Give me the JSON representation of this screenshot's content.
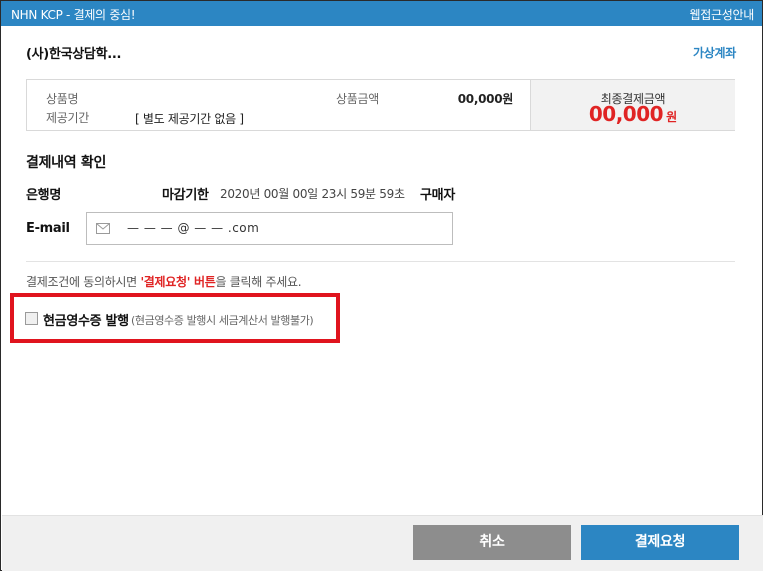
{
  "titlebar": {
    "title": "NHN KCP - 결제의 중심!",
    "accessibility_link": "웹접근성안내"
  },
  "merchant": {
    "name": "(사)한국상담학...",
    "payment_method": "가상계좌"
  },
  "summary": {
    "product_name_label": "상품명",
    "service_period_label": "제공기간",
    "service_period_value": "[ 별도 제공기간 없음 ]",
    "product_amount_label": "상품금액",
    "product_amount_value": "00,000원",
    "final_amount_label": "최종결제금액",
    "final_amount_value": "00,000",
    "final_amount_unit": "원"
  },
  "details": {
    "section_title": "결제내역 확인",
    "bank_label": "은행명",
    "deadline_label": "마감기한",
    "deadline_value": "2020년 00월 00일 23시 59분 59초",
    "buyer_label": "구매자",
    "email_label": "E-mail",
    "email_value": "— — — @ — — .com"
  },
  "notice": {
    "prefix": "결제조건에 동의하시면 ",
    "highlight": "'결제요청' 버튼",
    "suffix": "을 클릭해 주세요."
  },
  "receipt": {
    "label": "현금영수증 발행",
    "note": "(현금영수증 발행시 세금계산서 발행불가)",
    "checked": false
  },
  "buttons": {
    "cancel": "취소",
    "pay": "결제요청"
  },
  "colors": {
    "brand_blue": "#2c86c3",
    "amount_red": "#e02424",
    "highlight_box": "#e0141e",
    "cancel_gray": "#8d8d8d"
  }
}
